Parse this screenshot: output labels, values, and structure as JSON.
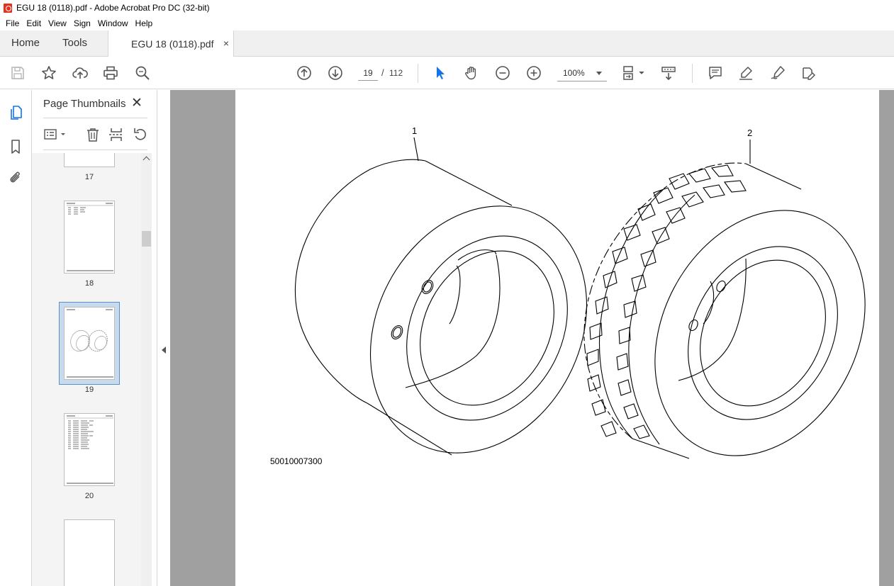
{
  "window": {
    "title": "EGU 18 (0118).pdf - Adobe Acrobat Pro DC (32-bit)"
  },
  "menu": [
    "File",
    "Edit",
    "View",
    "Sign",
    "Window",
    "Help"
  ],
  "tabs": {
    "home": "Home",
    "tools": "Tools",
    "document": "EGU 18 (0118).pdf",
    "close_glyph": "×"
  },
  "toolbar": {
    "current_page": "19",
    "page_separator": "/",
    "total_pages": "112",
    "zoom": "100%"
  },
  "panel": {
    "title": "Page Thumbnails",
    "close_glyph": "✕",
    "thumbnails": [
      {
        "label": "17"
      },
      {
        "label": "18"
      },
      {
        "label": "19",
        "selected": true
      },
      {
        "label": "20"
      }
    ]
  },
  "document": {
    "callouts": [
      "1",
      "2"
    ],
    "drawing_number": "50010007300"
  },
  "colors": {
    "accent": "#1473e6",
    "selection": "#c8dbee",
    "canvas": "#a0a0a0"
  }
}
